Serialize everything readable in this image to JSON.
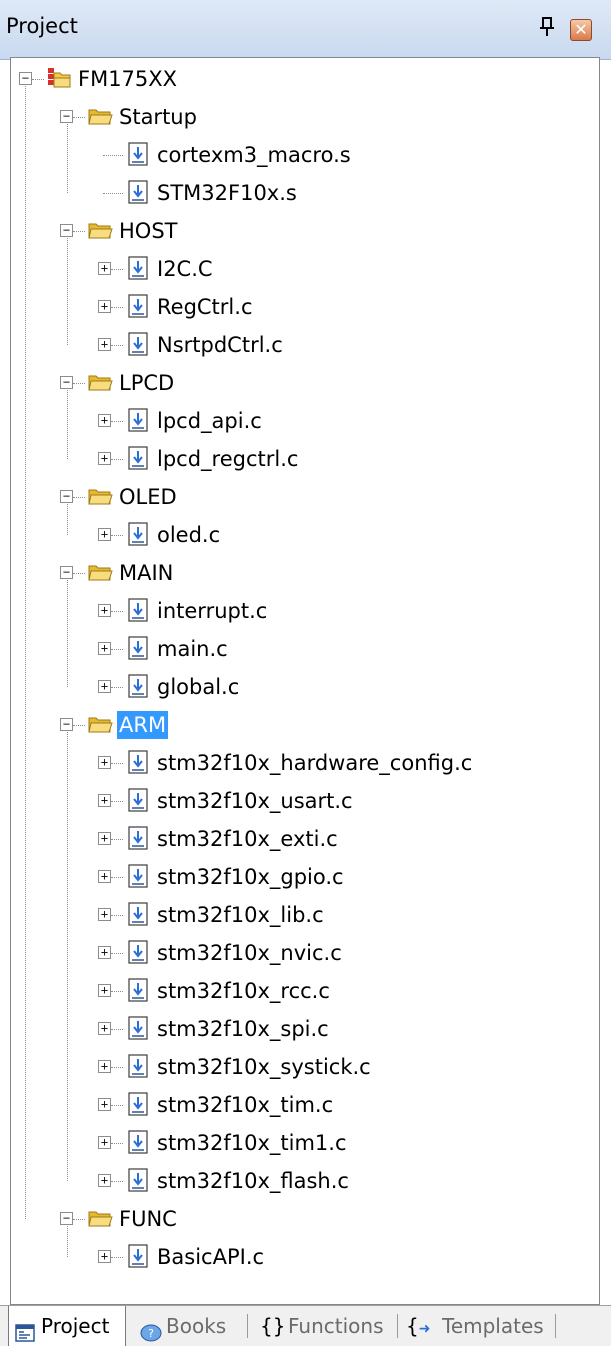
{
  "window": {
    "title": "Project",
    "pin_glyph": "ᵽ",
    "close_glyph": "✕"
  },
  "tree": {
    "root": "FM175XX",
    "groups": [
      {
        "name": "Startup",
        "files": [
          "cortexm3_macro.s",
          "STM32F10x.s"
        ],
        "files_expandable": false
      },
      {
        "name": "HOST",
        "files": [
          "I2C.C",
          "RegCtrl.c",
          "NsrtpdCtrl.c"
        ],
        "files_expandable": true
      },
      {
        "name": "LPCD",
        "files": [
          "lpcd_api.c",
          "lpcd_regctrl.c"
        ],
        "files_expandable": true
      },
      {
        "name": "OLED",
        "files": [
          "oled.c"
        ],
        "files_expandable": true
      },
      {
        "name": "MAIN",
        "files": [
          "interrupt.c",
          "main.c",
          "global.c"
        ],
        "files_expandable": true
      },
      {
        "name": "ARM",
        "selected": true,
        "files": [
          "stm32f10x_hardware_config.c",
          "stm32f10x_usart.c",
          "stm32f10x_exti.c",
          "stm32f10x_gpio.c",
          "stm32f10x_lib.c",
          "stm32f10x_nvic.c",
          "stm32f10x_rcc.c",
          "stm32f10x_spi.c",
          "stm32f10x_systick.c",
          "stm32f10x_tim.c",
          "stm32f10x_tim1.c",
          "stm32f10x_flash.c"
        ],
        "files_expandable": true
      },
      {
        "name": "FUNC",
        "files": [
          "BasicAPI.c"
        ],
        "files_expandable": true
      }
    ]
  },
  "tabs": [
    {
      "label": "Project",
      "icon": "project-icon",
      "active": true
    },
    {
      "label": "Books",
      "icon": "books-icon",
      "active": false
    },
    {
      "label": "Functions",
      "icon": "functions-icon",
      "active": false
    },
    {
      "label": "Templates",
      "icon": "templates-icon",
      "active": false
    }
  ],
  "colors": {
    "selection": "#3399ff",
    "folder": "#f2c94c",
    "titlebar": "#c9d9ef"
  }
}
